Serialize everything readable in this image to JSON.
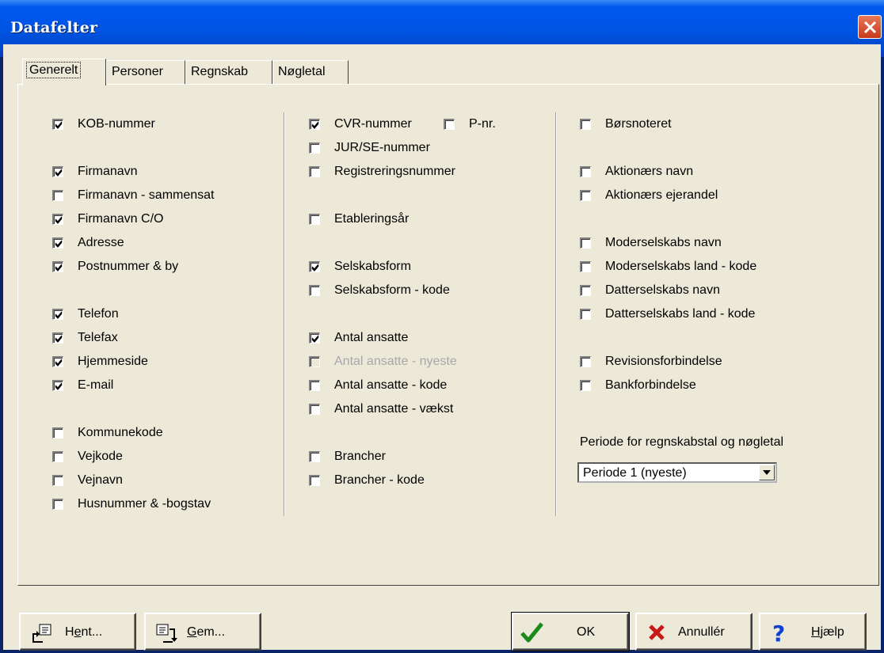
{
  "window": {
    "title": "Datafelter"
  },
  "tabs": [
    {
      "label": "Generelt",
      "active": true
    },
    {
      "label": "Personer",
      "active": false
    },
    {
      "label": "Regnskab",
      "active": false
    },
    {
      "label": "Nøgletal",
      "active": false
    }
  ],
  "columns": {
    "col1": [
      {
        "label": "KOB-nummer",
        "checked": true
      },
      {
        "label": "Firmanavn",
        "checked": true
      },
      {
        "label": "Firmanavn - sammensat",
        "checked": false
      },
      {
        "label": "Firmanavn C/O",
        "checked": true
      },
      {
        "label": "Adresse",
        "checked": true
      },
      {
        "label": "Postnummer & by",
        "checked": true
      },
      {
        "label": "Telefon",
        "checked": true
      },
      {
        "label": "Telefax",
        "checked": true
      },
      {
        "label": "Hjemmeside",
        "checked": true
      },
      {
        "label": "E-mail",
        "checked": true
      },
      {
        "label": "Kommunekode",
        "checked": false
      },
      {
        "label": "Vejkode",
        "checked": false
      },
      {
        "label": "Vejnavn",
        "checked": false
      },
      {
        "label": "Husnummer & -bogstav",
        "checked": false
      }
    ],
    "col2": [
      {
        "label": "CVR-nummer",
        "checked": true
      },
      {
        "label": "P-nr.",
        "checked": false
      },
      {
        "label": "JUR/SE-nummer",
        "checked": false
      },
      {
        "label": "Registreringsnummer",
        "checked": false
      },
      {
        "label": "Etableringsår",
        "checked": false
      },
      {
        "label": "Selskabsform",
        "checked": true
      },
      {
        "label": "Selskabsform - kode",
        "checked": false
      },
      {
        "label": "Antal ansatte",
        "checked": true
      },
      {
        "label": "Antal ansatte - nyeste",
        "checked": false,
        "disabled": true
      },
      {
        "label": "Antal ansatte - kode",
        "checked": false
      },
      {
        "label": "Antal ansatte - vækst",
        "checked": false
      },
      {
        "label": "Brancher",
        "checked": false
      },
      {
        "label": "Brancher - kode",
        "checked": false
      }
    ],
    "col3": [
      {
        "label": "Børsnoteret",
        "checked": false
      },
      {
        "label": "Aktionærs navn",
        "checked": false
      },
      {
        "label": "Aktionærs ejerandel",
        "checked": false
      },
      {
        "label": "Moderselskabs navn",
        "checked": false
      },
      {
        "label": "Moderselskabs land - kode",
        "checked": false
      },
      {
        "label": "Datterselskabs navn",
        "checked": false
      },
      {
        "label": "Datterselskabs land - kode",
        "checked": false
      },
      {
        "label": "Revisionsforbindelse",
        "checked": false
      },
      {
        "label": "Bankforbindelse",
        "checked": false
      }
    ]
  },
  "periode": {
    "label": "Periode for regnskabstal og nøgletal",
    "value": "Periode 1 (nyeste)"
  },
  "buttons": {
    "hent": {
      "pre": "H",
      "u": "e",
      "post": "nt..."
    },
    "gem": {
      "pre": "",
      "u": "G",
      "post": "em..."
    },
    "ok": "OK",
    "annuller": "Annullér",
    "hjaelp": {
      "pre": "",
      "u": "H",
      "post": "jælp"
    }
  },
  "icons": {
    "ok": "checkmark-icon",
    "cancel": "x-icon",
    "help": "question-icon"
  }
}
